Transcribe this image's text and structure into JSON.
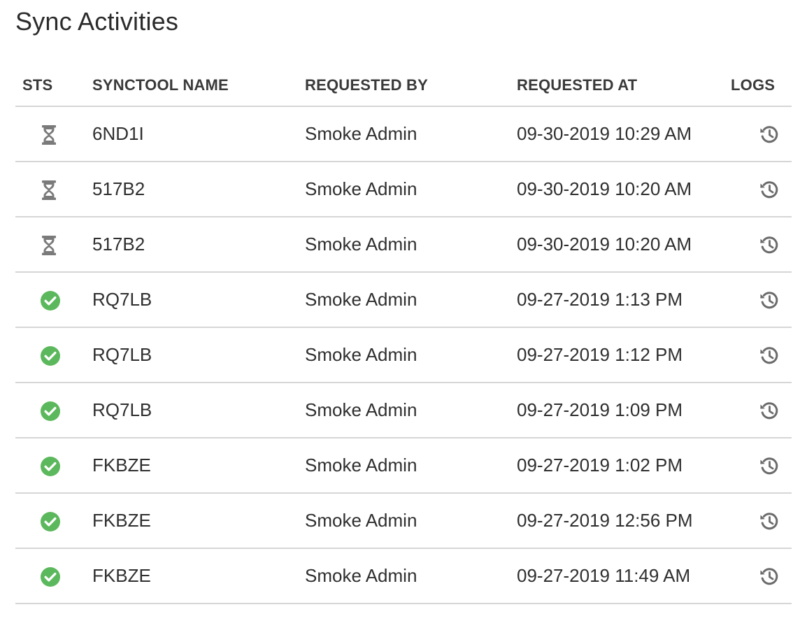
{
  "page": {
    "title": "Sync Activities"
  },
  "table": {
    "columns": {
      "status": "STS",
      "name": "SYNCTOOL NAME",
      "requested_by": "REQUESTED BY",
      "requested_at": "REQUESTED AT",
      "logs": "LOGS"
    },
    "rows": [
      {
        "status": "pending",
        "status_icon": "hourglass-icon",
        "name": "6ND1I",
        "requested_by": "Smoke Admin",
        "requested_at": "09-30-2019 10:29 AM",
        "logs_icon": "history-icon"
      },
      {
        "status": "pending",
        "status_icon": "hourglass-icon",
        "name": "517B2",
        "requested_by": "Smoke Admin",
        "requested_at": "09-30-2019 10:20 AM",
        "logs_icon": "history-icon"
      },
      {
        "status": "pending",
        "status_icon": "hourglass-icon",
        "name": "517B2",
        "requested_by": "Smoke Admin",
        "requested_at": "09-30-2019 10:20 AM",
        "logs_icon": "history-icon"
      },
      {
        "status": "success",
        "status_icon": "check-circle-icon",
        "name": "RQ7LB",
        "requested_by": "Smoke Admin",
        "requested_at": "09-27-2019 1:13 PM",
        "logs_icon": "history-icon"
      },
      {
        "status": "success",
        "status_icon": "check-circle-icon",
        "name": "RQ7LB",
        "requested_by": "Smoke Admin",
        "requested_at": "09-27-2019 1:12 PM",
        "logs_icon": "history-icon"
      },
      {
        "status": "success",
        "status_icon": "check-circle-icon",
        "name": "RQ7LB",
        "requested_by": "Smoke Admin",
        "requested_at": "09-27-2019 1:09 PM",
        "logs_icon": "history-icon"
      },
      {
        "status": "success",
        "status_icon": "check-circle-icon",
        "name": "FKBZE",
        "requested_by": "Smoke Admin",
        "requested_at": "09-27-2019 1:02 PM",
        "logs_icon": "history-icon"
      },
      {
        "status": "success",
        "status_icon": "check-circle-icon",
        "name": "FKBZE",
        "requested_by": "Smoke Admin",
        "requested_at": "09-27-2019 12:56 PM",
        "logs_icon": "history-icon"
      },
      {
        "status": "success",
        "status_icon": "check-circle-icon",
        "name": "FKBZE",
        "requested_by": "Smoke Admin",
        "requested_at": "09-27-2019 11:49 AM",
        "logs_icon": "history-icon"
      }
    ]
  },
  "colors": {
    "success": "#5cb85c",
    "pending": "#7a7a7a",
    "logs_icon": "#6b6b6b",
    "divider": "#d6d6d6"
  }
}
